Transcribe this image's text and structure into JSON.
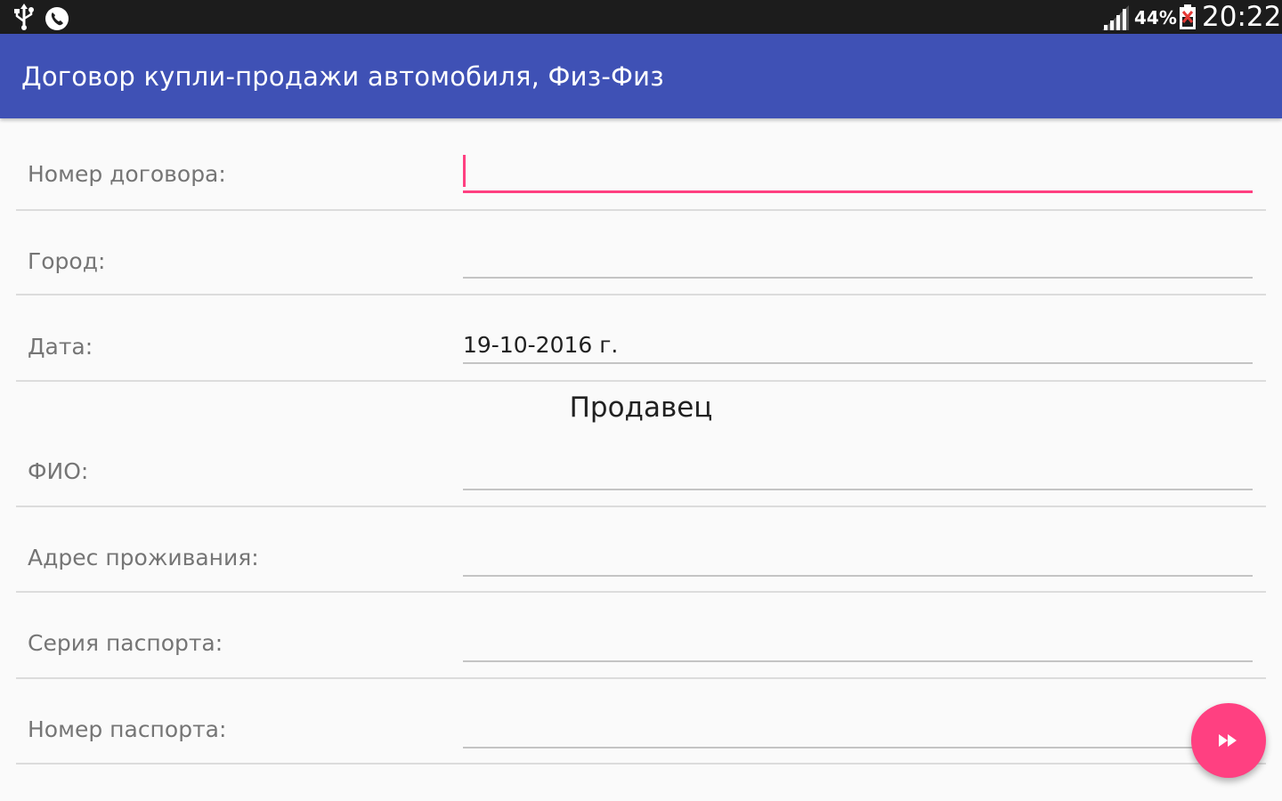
{
  "status_bar": {
    "battery_percent": "44%",
    "time": "20:22",
    "icons": [
      "usb-icon",
      "phone-icon",
      "signal-icon",
      "battery-icon"
    ]
  },
  "app_bar": {
    "title": "Договор купли-продажи автомобиля, Физ-Физ",
    "color": "#3f51b5"
  },
  "form": {
    "contract_number": {
      "label": "Номер договора:",
      "value": ""
    },
    "city": {
      "label": "Город:",
      "value": ""
    },
    "date": {
      "label": "Дата:",
      "value": "19-10-2016 г."
    },
    "seller_section": "Продавец",
    "full_name": {
      "label": "ФИО:",
      "value": ""
    },
    "address": {
      "label": "Адрес проживания:",
      "value": ""
    },
    "passport_series": {
      "label": "Серия паспорта:",
      "value": ""
    },
    "passport_number": {
      "label": "Номер паспорта:",
      "value": ""
    }
  },
  "fab": {
    "icon": "fast-forward-icon",
    "color": "#ff4081"
  }
}
